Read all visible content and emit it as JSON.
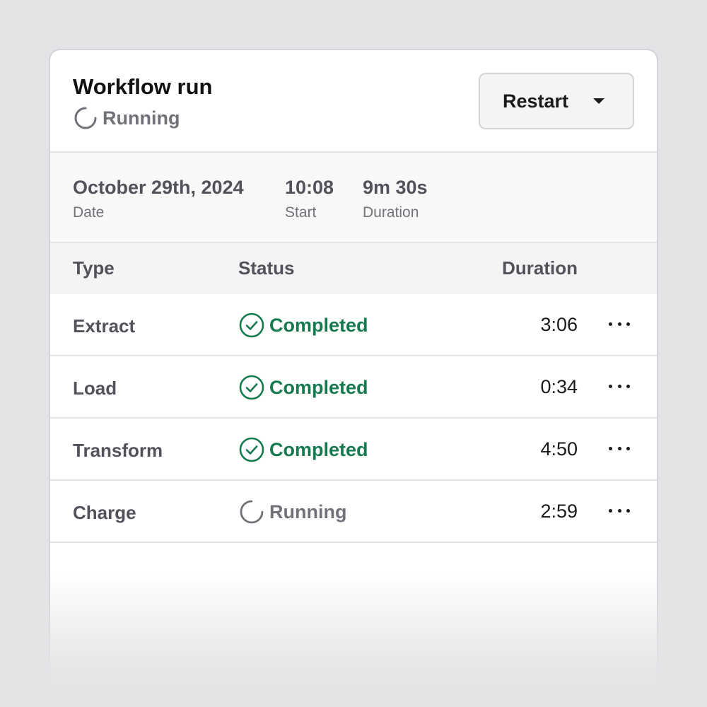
{
  "header": {
    "title": "Workflow run",
    "status_label": "Running",
    "status_icon": "spinner-icon",
    "restart_label": "Restart",
    "restart_icon": "caret-down-icon"
  },
  "meta": {
    "date_value": "October 29th, 2024",
    "date_caption": "Date",
    "start_value": "10:08",
    "start_caption": "Start",
    "duration_value": "9m 30s",
    "duration_caption": "Duration"
  },
  "table": {
    "columns": [
      "Type",
      "Status",
      "Duration"
    ],
    "rows": [
      {
        "type": "Extract",
        "status": "Completed",
        "status_kind": "completed",
        "duration": "3:06"
      },
      {
        "type": "Load",
        "status": "Completed",
        "status_kind": "completed",
        "duration": "0:34"
      },
      {
        "type": "Transform",
        "status": "Completed",
        "status_kind": "completed",
        "duration": "4:50"
      },
      {
        "type": "Charge",
        "status": "Running",
        "status_kind": "running",
        "duration": "2:59"
      }
    ]
  },
  "colors": {
    "completed": "#157a4f",
    "running": "#71717a",
    "background": "#e4e4e7"
  }
}
